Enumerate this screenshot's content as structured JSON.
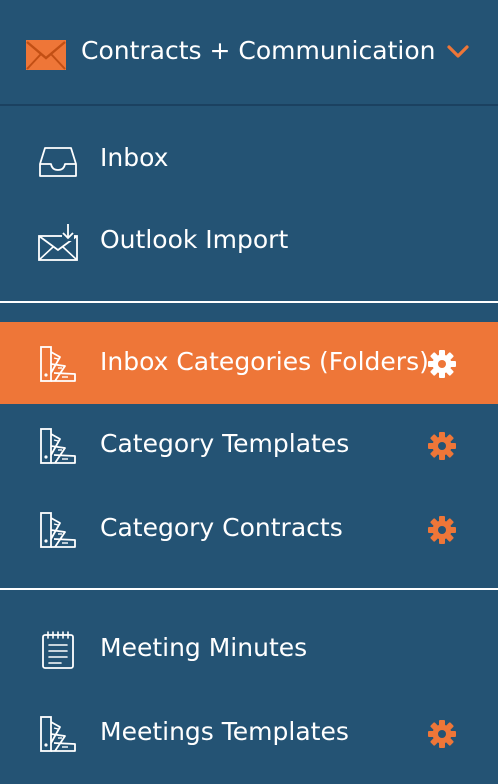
{
  "header": {
    "title": "Contracts + Communication",
    "icon": "envelope-icon",
    "chevron": "chevron-down-icon"
  },
  "colors": {
    "background": "#245374",
    "accent": "#ee7638",
    "text": "#ffffff"
  },
  "menu": {
    "inbox": {
      "label": "Inbox",
      "icon": "inbox-tray-icon"
    },
    "outlook_import": {
      "label": "Outlook Import",
      "icon": "mail-import-icon"
    },
    "inbox_categories": {
      "label": "Inbox Categories (Folders)",
      "icon": "color-swatch-icon",
      "active": true
    },
    "category_templates": {
      "label": "Category Templates",
      "icon": "color-swatch-icon"
    },
    "category_contracts": {
      "label": "Category Contracts",
      "icon": "color-swatch-icon"
    },
    "meeting_minutes": {
      "label": "Meeting Minutes",
      "icon": "notepad-icon"
    },
    "meetings_templates": {
      "label": "Meetings Templates",
      "icon": "color-swatch-icon"
    }
  }
}
